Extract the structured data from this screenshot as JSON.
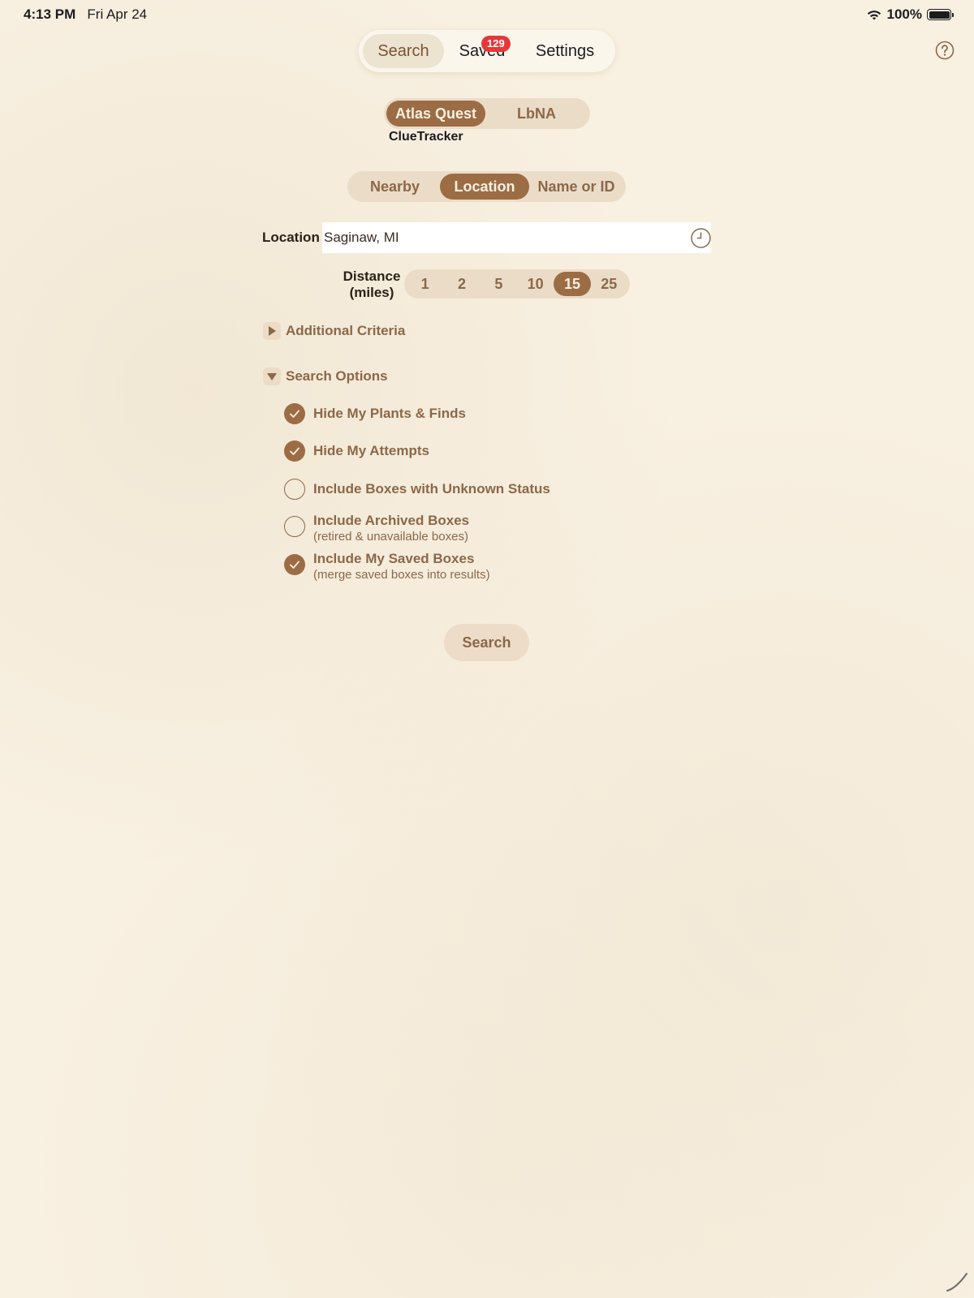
{
  "status_bar": {
    "time": "4:13 PM",
    "date": "Fri Apr 24",
    "battery": "100%"
  },
  "top_tabs": [
    {
      "label": "Search",
      "active": true
    },
    {
      "label": "Saved",
      "active": false,
      "badge": "129"
    },
    {
      "label": "Settings",
      "active": false
    }
  ],
  "source": {
    "options": [
      {
        "label": "Atlas Quest",
        "active": true
      },
      {
        "label": "LbNA",
        "active": false
      }
    ],
    "sub_label": "ClueTracker"
  },
  "mode": {
    "options": [
      {
        "label": "Nearby",
        "active": false
      },
      {
        "label": "Location",
        "active": true
      },
      {
        "label": "Name or ID",
        "active": false
      }
    ]
  },
  "location": {
    "label": "Location",
    "value": "Saginaw, MI"
  },
  "distance": {
    "label_line1": "Distance",
    "label_line2": "(miles)",
    "options": [
      "1",
      "2",
      "5",
      "10",
      "15",
      "25"
    ],
    "selected": "15"
  },
  "additional_criteria": {
    "label": "Additional Criteria",
    "expanded": false
  },
  "search_options": {
    "label": "Search Options",
    "expanded": true,
    "items": [
      {
        "label": "Hide My Plants & Finds",
        "sub": "",
        "checked": true
      },
      {
        "label": "Hide My Attempts",
        "sub": "",
        "checked": true
      },
      {
        "label": "Include Boxes with Unknown Status",
        "sub": "",
        "checked": false
      },
      {
        "label": "Include Archived Boxes",
        "sub": "(retired & unavailable boxes)",
        "checked": false
      },
      {
        "label": "Include My Saved Boxes",
        "sub": "(merge saved boxes into results)",
        "checked": true
      }
    ]
  },
  "search_button": {
    "label": "Search"
  },
  "colors": {
    "accent": "#9c6c45",
    "accent_text": "#8b6848",
    "segment_bg": "#ebdcc8",
    "background": "#f8f0e1",
    "badge": "#e5383b"
  }
}
